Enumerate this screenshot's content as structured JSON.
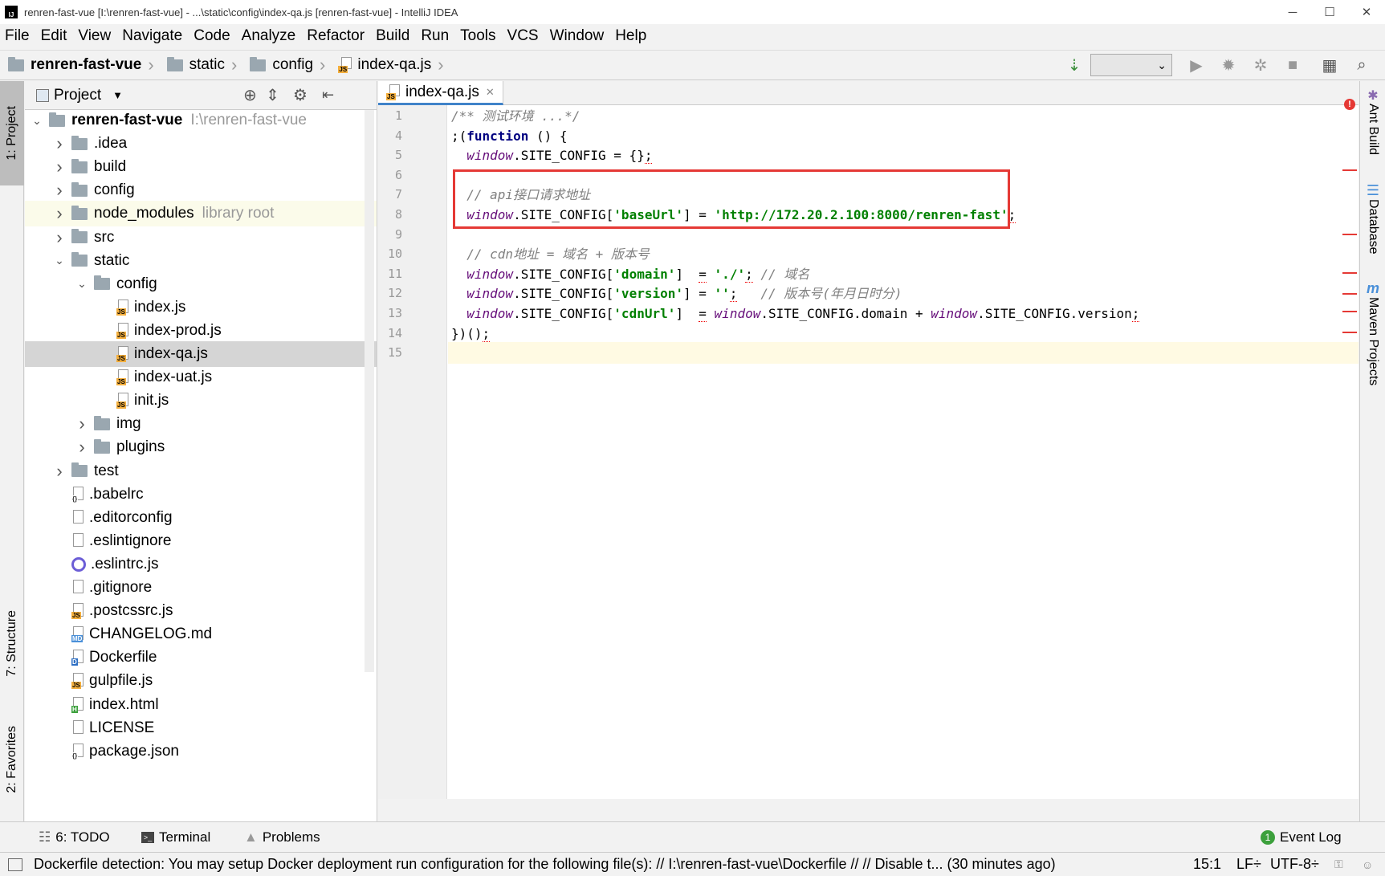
{
  "window": {
    "title": "renren-fast-vue [I:\\renren-fast-vue] - ...\\static\\config\\index-qa.js [renren-fast-vue] - IntelliJ IDEA",
    "minimize": "─",
    "maximize": "☐",
    "close": "✕"
  },
  "menu": [
    "File",
    "Edit",
    "View",
    "Navigate",
    "Code",
    "Analyze",
    "Refactor",
    "Build",
    "Run",
    "Tools",
    "VCS",
    "Window",
    "Help"
  ],
  "breadcrumb": [
    "renren-fast-vue",
    "static",
    "config",
    "index-qa.js"
  ],
  "left_tabs": {
    "project": "1: Project",
    "structure": "7: Structure",
    "favorites": "2: Favorites"
  },
  "right_tabs": {
    "ant": "Ant Build",
    "database": "Database",
    "maven": "Maven Projects"
  },
  "project_panel": {
    "title": "Project",
    "tree": [
      {
        "label": "renren-fast-vue",
        "extra": "I:\\renren-fast-vue",
        "type": "module",
        "arrow": "v",
        "bold": true
      },
      {
        "label": ".idea",
        "type": "folder",
        "arrow": ">"
      },
      {
        "label": "build",
        "type": "folder",
        "arrow": ">"
      },
      {
        "label": "config",
        "type": "folder",
        "arrow": ">"
      },
      {
        "label": "node_modules",
        "extra": "library root",
        "type": "folder",
        "arrow": ">"
      },
      {
        "label": "src",
        "type": "folder",
        "arrow": ">"
      },
      {
        "label": "static",
        "type": "folder",
        "arrow": "v"
      },
      {
        "label": "config",
        "type": "folder",
        "arrow": "v"
      },
      {
        "label": "index.js",
        "type": "js"
      },
      {
        "label": "index-prod.js",
        "type": "js"
      },
      {
        "label": "index-qa.js",
        "type": "js",
        "selected": true
      },
      {
        "label": "index-uat.js",
        "type": "js"
      },
      {
        "label": "init.js",
        "type": "js"
      },
      {
        "label": "img",
        "type": "folder",
        "arrow": ">"
      },
      {
        "label": "plugins",
        "type": "folder",
        "arrow": ">"
      },
      {
        "label": "test",
        "type": "folder",
        "arrow": ">"
      },
      {
        "label": ".babelrc",
        "type": "json"
      },
      {
        "label": ".editorconfig",
        "type": "text"
      },
      {
        "label": ".eslintignore",
        "type": "text"
      },
      {
        "label": ".eslintrc.js",
        "type": "eslint"
      },
      {
        "label": ".gitignore",
        "type": "text"
      },
      {
        "label": ".postcssrc.js",
        "type": "js"
      },
      {
        "label": "CHANGELOG.md",
        "type": "md"
      },
      {
        "label": "Dockerfile",
        "type": "docker"
      },
      {
        "label": "gulpfile.js",
        "type": "js"
      },
      {
        "label": "index.html",
        "type": "html"
      },
      {
        "label": "LICENSE",
        "type": "text"
      },
      {
        "label": "package.json",
        "type": "json"
      }
    ]
  },
  "editor": {
    "tab": "index-qa.js",
    "line_numbers": [
      "1",
      "4",
      "5",
      "6",
      "7",
      "8",
      "9",
      "10",
      "11",
      "12",
      "13",
      "14",
      "15"
    ],
    "lines": [
      [
        {
          "t": "/** ",
          "c": "c"
        },
        {
          "t": "测试环境 ...*/",
          "c": "c"
        }
      ],
      [
        {
          "t": ";(",
          "c": ""
        },
        {
          "t": "function",
          "c": "k"
        },
        {
          "t": " () {",
          "c": ""
        }
      ],
      [
        {
          "t": "  ",
          "c": ""
        },
        {
          "t": "window",
          "c": "w"
        },
        {
          "t": ".SITE_CONFIG = {}",
          "c": ""
        },
        {
          "t": ";",
          "c": "err"
        }
      ],
      [],
      [
        {
          "t": "  // api接口请求地址",
          "c": "c"
        }
      ],
      [
        {
          "t": "  ",
          "c": ""
        },
        {
          "t": "window",
          "c": "w"
        },
        {
          "t": ".SITE_CONFIG[",
          "c": ""
        },
        {
          "t": "'baseUrl'",
          "c": "s"
        },
        {
          "t": "] = ",
          "c": ""
        },
        {
          "t": "'http://172.20.2.100:8000/renren-fast'",
          "c": "s"
        },
        {
          "t": ";",
          "c": "err"
        }
      ],
      [],
      [
        {
          "t": "  // cdn地址 = 域名 + 版本号",
          "c": "c"
        }
      ],
      [
        {
          "t": "  ",
          "c": ""
        },
        {
          "t": "window",
          "c": "w"
        },
        {
          "t": ".SITE_CONFIG[",
          "c": ""
        },
        {
          "t": "'domain'",
          "c": "s"
        },
        {
          "t": "]  ",
          "c": ""
        },
        {
          "t": "=",
          "c": "err"
        },
        {
          "t": " ",
          "c": ""
        },
        {
          "t": "'./'",
          "c": "s"
        },
        {
          "t": ";",
          "c": "err"
        },
        {
          "t": " // 域名",
          "c": "c"
        }
      ],
      [
        {
          "t": "  ",
          "c": ""
        },
        {
          "t": "window",
          "c": "w"
        },
        {
          "t": ".SITE_CONFIG[",
          "c": ""
        },
        {
          "t": "'version'",
          "c": "s"
        },
        {
          "t": "] = ",
          "c": ""
        },
        {
          "t": "''",
          "c": "s"
        },
        {
          "t": ";",
          "c": "err"
        },
        {
          "t": "   // 版本号(年月日时分)",
          "c": "c"
        }
      ],
      [
        {
          "t": "  ",
          "c": ""
        },
        {
          "t": "window",
          "c": "w"
        },
        {
          "t": ".SITE_CONFIG[",
          "c": ""
        },
        {
          "t": "'cdnUrl'",
          "c": "s"
        },
        {
          "t": "]  ",
          "c": ""
        },
        {
          "t": "=",
          "c": "err"
        },
        {
          "t": " ",
          "c": ""
        },
        {
          "t": "window",
          "c": "w"
        },
        {
          "t": ".SITE_CONFIG.domain + ",
          "c": ""
        },
        {
          "t": "window",
          "c": "w"
        },
        {
          "t": ".SITE_CONFIG.version",
          "c": ""
        },
        {
          "t": ";",
          "c": "err"
        }
      ],
      [
        {
          "t": "})()",
          "c": ""
        },
        {
          "t": ";",
          "c": "err"
        }
      ],
      []
    ]
  },
  "bottom_tabs": {
    "todo": "6: TODO",
    "terminal": "Terminal",
    "problems": "Problems",
    "event_log": "Event Log",
    "event_count": "1"
  },
  "status": {
    "message": "Dockerfile detection: You may setup Docker deployment run configuration for the following file(s): // I:\\renren-fast-vue\\Dockerfile // // Disable t... (30 minutes ago)",
    "position": "15:1",
    "line_sep": "LF÷",
    "encoding": "UTF-8÷"
  },
  "colors": {
    "highlight_box": "#e53935",
    "selection": "#d5d5d5",
    "error_marker": "#e53935"
  }
}
